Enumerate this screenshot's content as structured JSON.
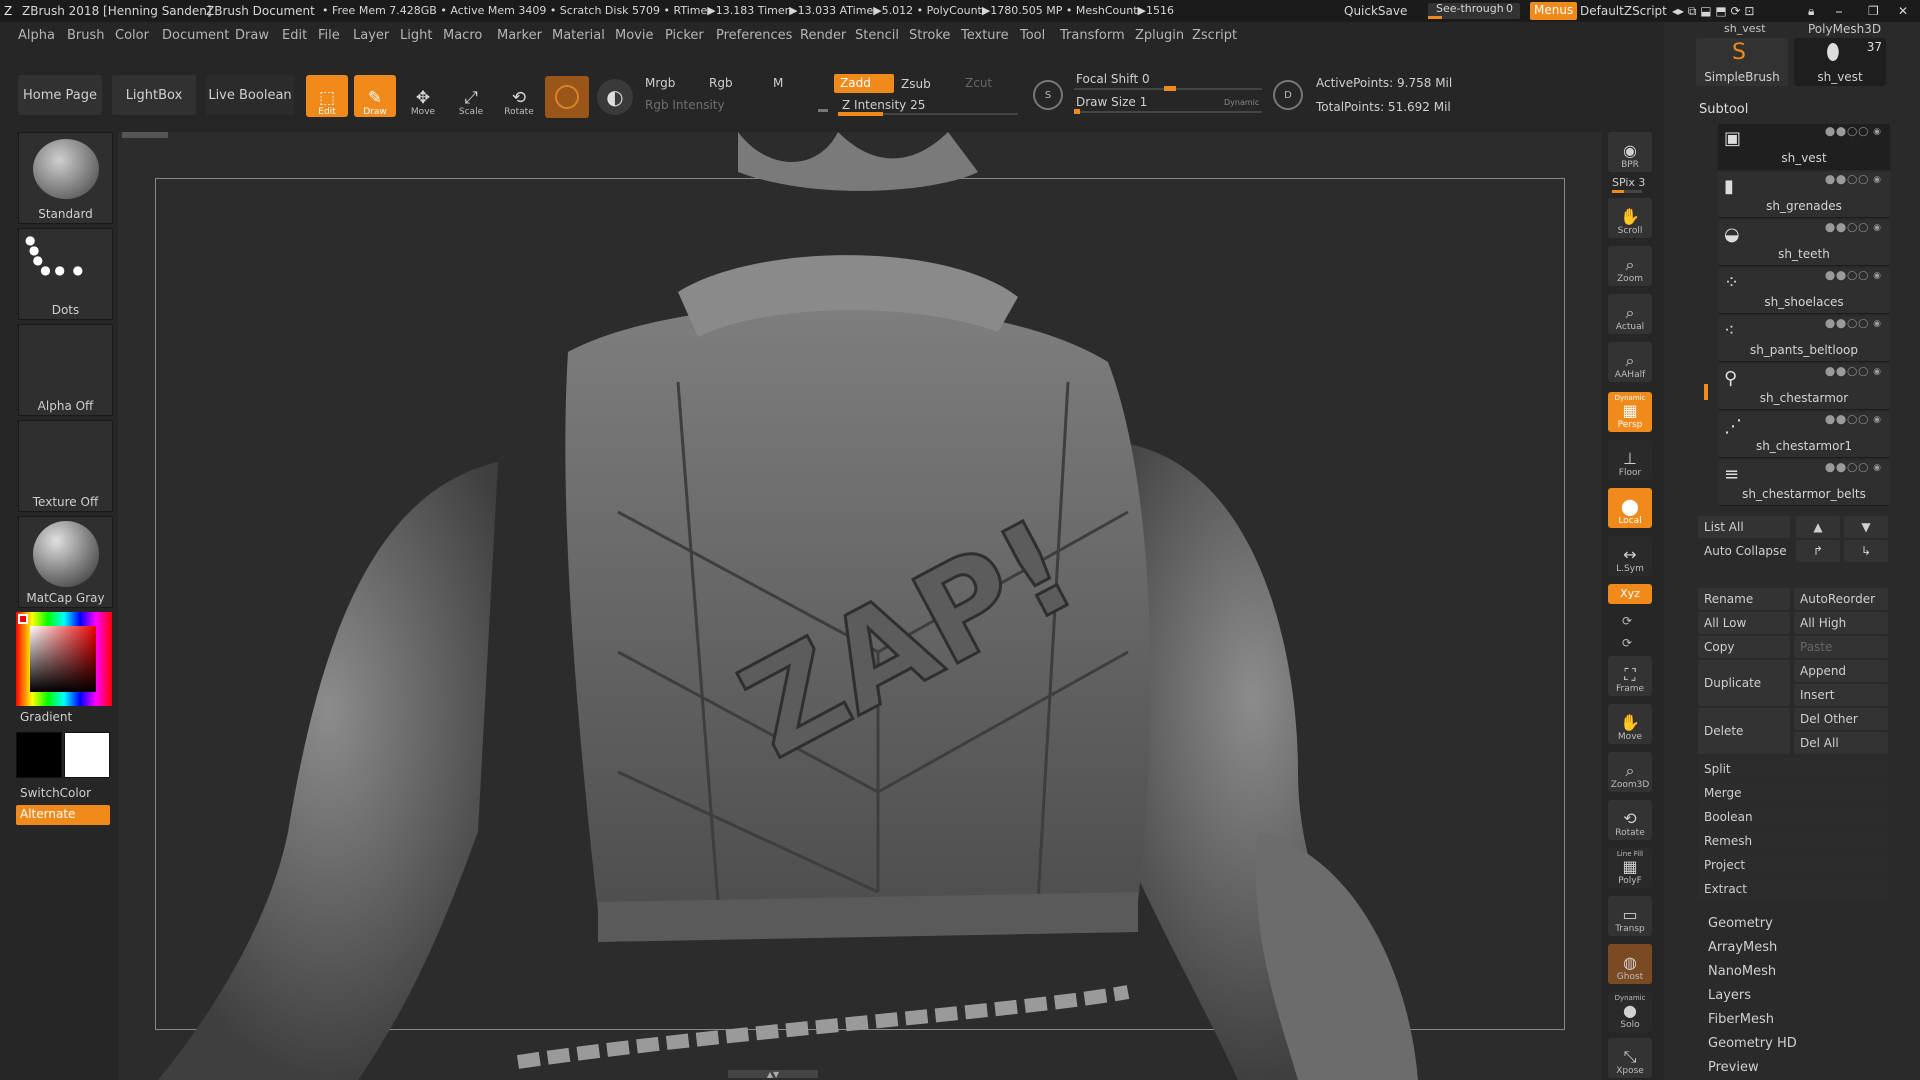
{
  "title": {
    "app": "ZBrush 2018 [Henning Sanden]",
    "doc": "ZBrush Document",
    "stats": "• Free Mem 7.428GB • Active Mem 3409 • Scratch Disk 5709 • RTime▶13.183 Timer▶13.033 ATime▶5.012 • PolyCount▶1780.505 MP • MeshCount▶1516",
    "quicksave": "QuickSave",
    "seethrough": "See-through",
    "seethrough_value": "0",
    "menus": "Menus",
    "script": "DefaultZScript"
  },
  "menubar": [
    "Alpha",
    "Brush",
    "Color",
    "Document",
    "Draw",
    "Edit",
    "File",
    "Layer",
    "Light",
    "Macro",
    "Marker",
    "Material",
    "Movie",
    "Picker",
    "Preferences",
    "Render",
    "Stencil",
    "Stroke",
    "Texture",
    "Tool",
    "Transform",
    "Zplugin",
    "Zscript"
  ],
  "toolbar": {
    "home": "Home Page",
    "lightbox": "LightBox",
    "liveboolean": "Live Boolean",
    "edit": "Edit",
    "draw": "Draw",
    "move": "Move",
    "scale": "Scale",
    "rotate": "Rotate",
    "mrgb": "Mrgb",
    "rgb": "Rgb",
    "m": "M",
    "zadd": "Zadd",
    "zsub": "Zsub",
    "zcut": "Zcut",
    "rgb_intensity": "Rgb Intensity",
    "z_intensity": "Z Intensity 25",
    "z_intensity_value": 0.25,
    "focal_shift": "Focal Shift 0",
    "focal_shift_value": 0.5,
    "draw_size": "Draw Size 1",
    "draw_size_value": 0.01,
    "dynamic": "Dynamic",
    "active_points": "ActivePoints: 9.758 Mil",
    "total_points": "TotalPoints: 51.692 Mil"
  },
  "left": {
    "brush": "Standard",
    "stroke": "Dots",
    "alpha": "Alpha Off",
    "texture": "Texture Off",
    "material": "MatCap Gray",
    "gradient": "Gradient",
    "switchcolor": "SwitchColor",
    "alternate": "Alternate"
  },
  "viewport": {
    "patch_text": "ZAP!"
  },
  "rightstrip": [
    {
      "label": "BPR",
      "icon": "bpr-icon"
    },
    {
      "label": "Scroll",
      "icon": "scroll-icon"
    },
    {
      "label": "Zoom",
      "icon": "zoom-icon"
    },
    {
      "label": "Actual",
      "icon": "actual-icon"
    },
    {
      "label": "AAHalf",
      "icon": "aahalf-icon"
    },
    {
      "label": "Persp",
      "icon": "persp-icon",
      "top": "Dynamic"
    },
    {
      "label": "Floor",
      "icon": "floor-icon"
    },
    {
      "label": "Local",
      "icon": "local-icon"
    },
    {
      "label": "L.Sym",
      "icon": "lsym-icon"
    },
    {
      "label": "Frame",
      "icon": "frame-icon"
    },
    {
      "label": "Move",
      "icon": "move-icon"
    },
    {
      "label": "Zoom3D",
      "icon": "zoom3d-icon"
    },
    {
      "label": "Rotate",
      "icon": "rotate-icon"
    },
    {
      "label": "PolyF",
      "icon": "polyf-icon",
      "top": "Line Fill"
    },
    {
      "label": "Transp",
      "icon": "transp-icon"
    },
    {
      "label": "Ghost",
      "icon": "ghost-icon"
    },
    {
      "label": "Solo",
      "icon": "solo-icon",
      "top": "Dynamic"
    },
    {
      "label": "Xpose",
      "icon": "xpose-icon"
    }
  ],
  "spix": "SPix 3",
  "xyz": "Xyz",
  "right": {
    "top_tools": [
      {
        "name": "sh_vest"
      },
      {
        "name": "PolyMesh3D"
      },
      {
        "name": "SimpleBrush"
      },
      {
        "name": "sh_vest",
        "count": "37"
      }
    ],
    "subtool_title": "Subtool",
    "subtools": [
      "sh_vest",
      "sh_grenades",
      "sh_teeth",
      "sh_shoelaces",
      "sh_pants_beltloop",
      "sh_chestarmor",
      "sh_chestarmor1",
      "sh_chestarmor_belts"
    ],
    "list_all": "List All",
    "auto_collapse": "Auto Collapse",
    "rename": "Rename",
    "autoreorder": "AutoReorder",
    "all_low": "All Low",
    "all_high": "All High",
    "copy": "Copy",
    "paste": "Paste",
    "duplicate": "Duplicate",
    "append": "Append",
    "insert": "Insert",
    "delete": "Delete",
    "del_other": "Del Other",
    "del_all": "Del All",
    "actions": [
      "Split",
      "Merge",
      "Boolean",
      "Remesh",
      "Project",
      "Extract"
    ],
    "palettes": [
      "Geometry",
      "ArrayMesh",
      "NanoMesh",
      "Layers",
      "FiberMesh",
      "Geometry HD",
      "Preview"
    ]
  }
}
